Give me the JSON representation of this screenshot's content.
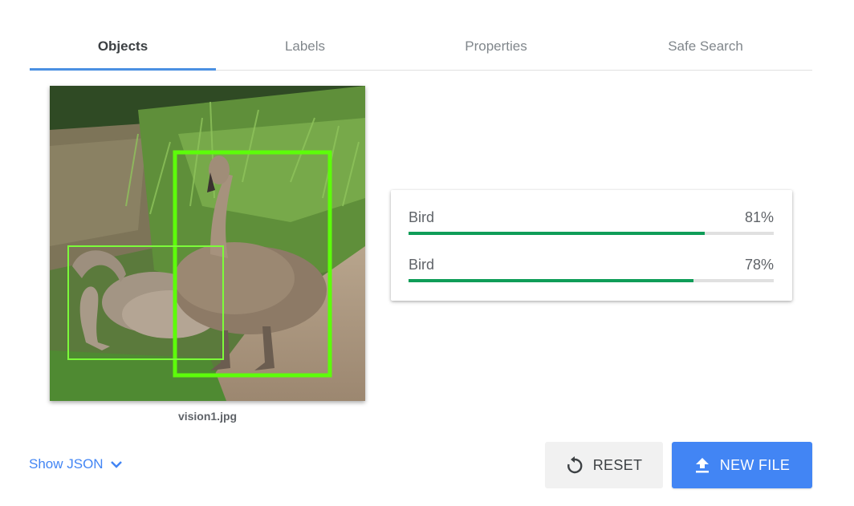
{
  "tabs": [
    {
      "label": "Objects",
      "active": true
    },
    {
      "label": "Labels",
      "active": false
    },
    {
      "label": "Properties",
      "active": false
    },
    {
      "label": "Safe Search",
      "active": false
    }
  ],
  "image": {
    "filename": "vision1.jpg",
    "detections": [
      {
        "label": "Bird",
        "score_text": "81%",
        "score": 0.81
      },
      {
        "label": "Bird",
        "score_text": "78%",
        "score": 0.78
      }
    ]
  },
  "footer": {
    "show_json_label": "Show JSON",
    "reset_label": "RESET",
    "new_file_label": "NEW FILE"
  },
  "colors": {
    "accent": "#4285f4",
    "tab_indicator": "#4a90e2",
    "score_bar": "#0f9d58",
    "box_primary": "#5dfc0a",
    "box_secondary": "#7cfc3a"
  },
  "icons": {
    "show_json": "chevron-down-icon",
    "reset": "refresh-icon",
    "new_file": "upload-icon"
  }
}
